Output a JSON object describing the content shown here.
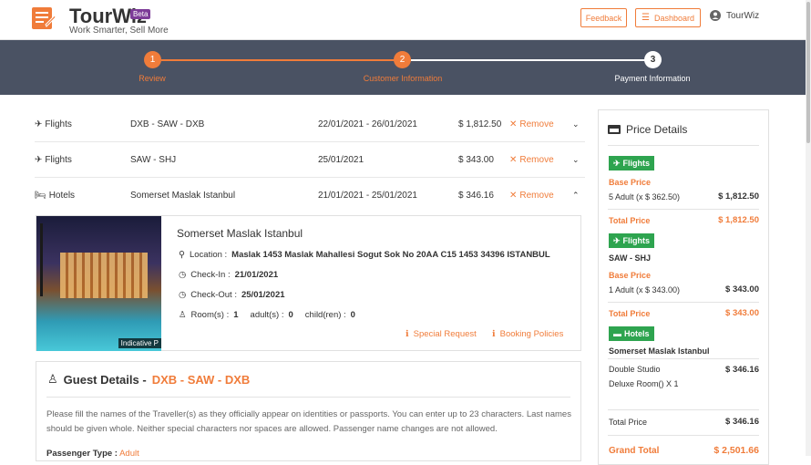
{
  "header": {
    "brand": "TourWiz",
    "beta": "Beta",
    "tagline": "Work Smarter, Sell More",
    "feedback_label": "Feedback",
    "dashboard_label": "Dashboard",
    "user_name": "TourWiz"
  },
  "steps": [
    {
      "num": "1",
      "label": "Review",
      "state": "done"
    },
    {
      "num": "2",
      "label": "Customer Information",
      "state": "active"
    },
    {
      "num": "3",
      "label": "Payment Information",
      "state": "pending"
    }
  ],
  "items": [
    {
      "type": "Flights",
      "route": "DXB - SAW - DXB",
      "dates": "22/01/2021 - 26/01/2021",
      "price": "$ 1,812.50",
      "remove": "Remove",
      "icon": "plane-icon",
      "expanded": false
    },
    {
      "type": "Flights",
      "route": "SAW - SHJ",
      "dates": "25/01/2021",
      "price": "$ 343.00",
      "remove": "Remove",
      "icon": "plane-icon",
      "expanded": false
    },
    {
      "type": "Hotels",
      "route": "Somerset Maslak Istanbul",
      "dates": "21/01/2021 - 25/01/2021",
      "price": "$ 346.16",
      "remove": "Remove",
      "icon": "bed-icon",
      "expanded": true
    }
  ],
  "hotel": {
    "name": "Somerset Maslak Istanbul",
    "image_caption": "Indicative P",
    "location_label": "Location :",
    "location": "Maslak 1453 Maslak Mahallesi Sogut Sok No 20AA C15 1453 34396 ISTANBUL",
    "checkin_label": "Check-In :",
    "checkin": "21/01/2021",
    "checkout_label": "Check-Out :",
    "checkout": "25/01/2021",
    "rooms_label": "Room(s) :",
    "rooms": "1",
    "adults_label": "adult(s) :",
    "adults": "0",
    "children_label": "child(ren) :",
    "children": "0",
    "special_request": "Special Request",
    "booking_policies": "Booking Policies"
  },
  "guest": {
    "title": "Guest Details -",
    "route": "DXB - SAW - DXB",
    "text": "Please fill the names of the Traveller(s) as they officially appear on identities or passports. You can enter up to 23 characters. Last names should be given whole. Neither special characters nor spaces are allowed. Passenger name changes are not allowed.",
    "ptype_label": "Passenger Type :",
    "ptype_value": "Adult"
  },
  "price_details": {
    "title": "Price Details",
    "flights_tag": "Flights",
    "base_price": "Base Price",
    "f1_line": "5 Adult (x $ 362.50)",
    "f1_amount": "$ 1,812.50",
    "total_price": "Total Price",
    "f1_total": "$ 1,812.50",
    "f2_route": "SAW - SHJ",
    "f2_line": "1 Adult (x $ 343.00)",
    "f2_amount": "$ 343.00",
    "f2_total": "$ 343.00",
    "hotels_tag": "Hotels",
    "hotel_name": "Somerset Maslak Istanbul",
    "room_line1": "Double Studio",
    "room_line2": "Deluxe Room() X 1",
    "room_amount": "$ 346.16",
    "hotel_total": "$ 346.16",
    "grand_total_label": "Grand Total",
    "grand_total": "$ 2,501.66"
  },
  "colors": {
    "accent": "#f07c3a",
    "stepper_bg": "#4a5263",
    "tag_green": "#2ea44f"
  }
}
